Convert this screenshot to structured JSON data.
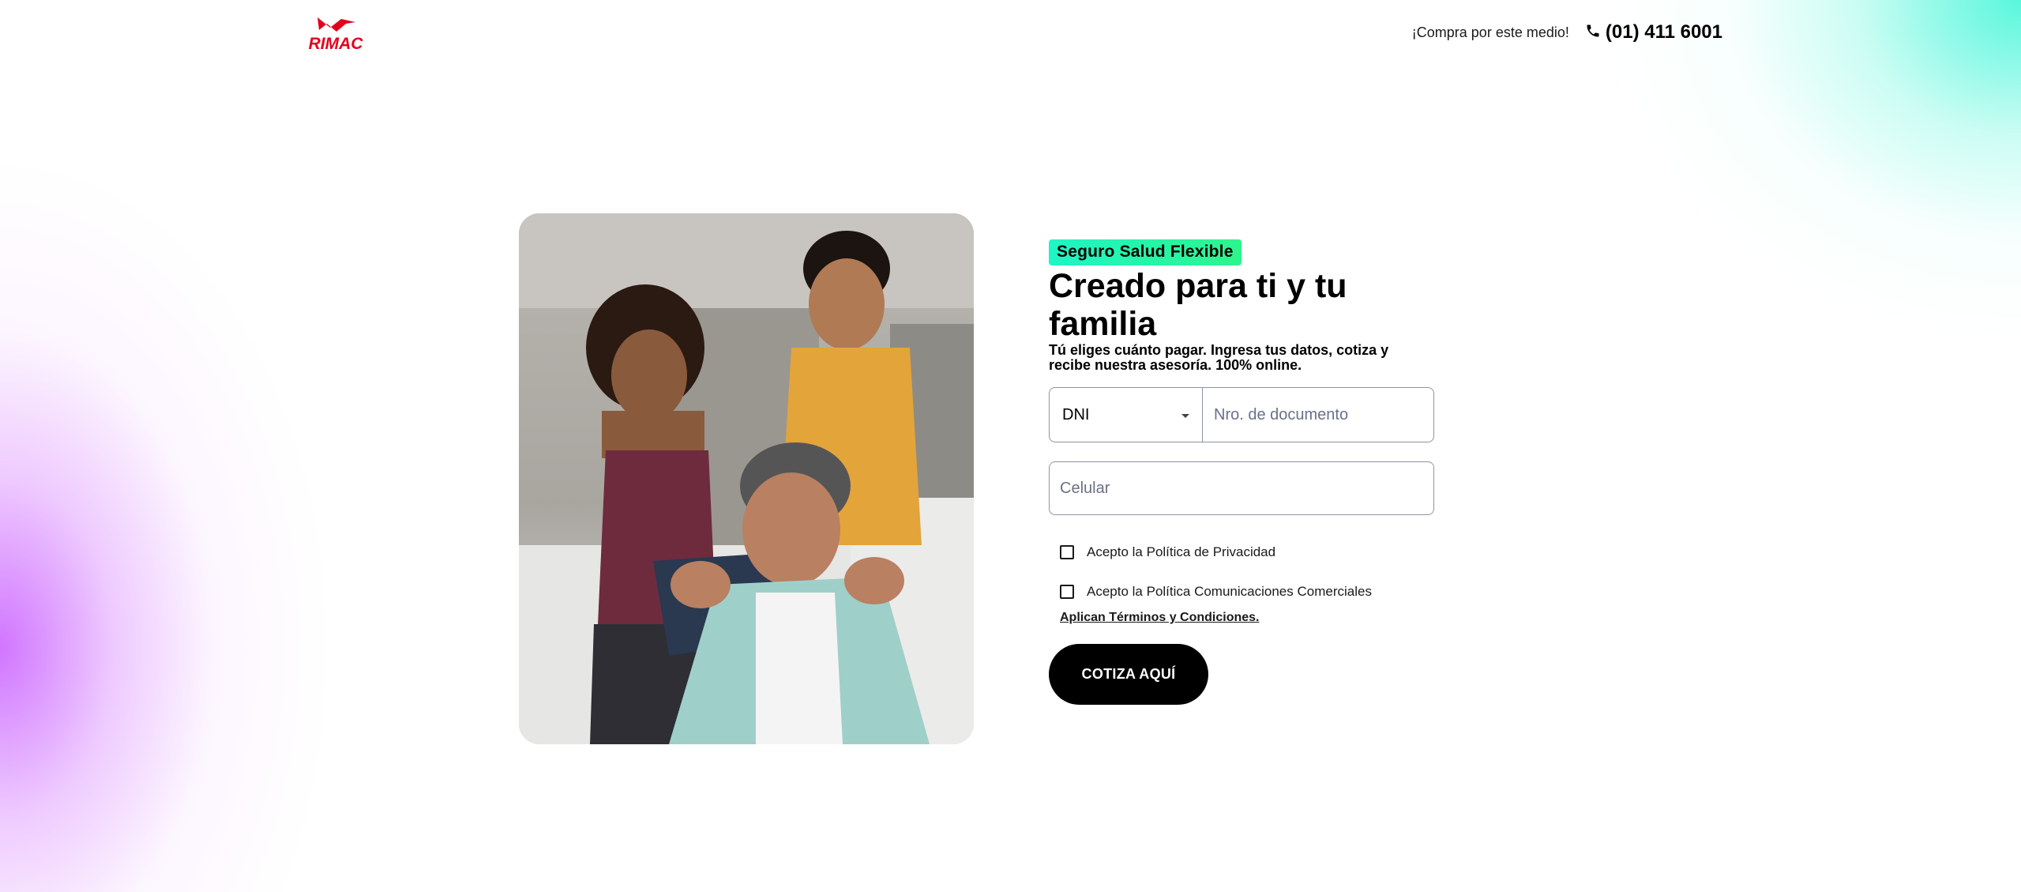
{
  "header": {
    "logo_text": "RIMAC",
    "buy_text": "¡Compra por este medio!",
    "phone_icon": "phone-icon",
    "phone_number": "(01) 411 6001"
  },
  "hero": {
    "image_icon": "family-photo"
  },
  "form": {
    "badge": "Seguro Salud Flexible",
    "title": "Creado para ti y tu familia",
    "subtitle": "Tú eliges cuánto pagar. Ingresa tus datos, cotiza y recibe nuestra asesoría. 100% online.",
    "doc_type_value": "DNI",
    "doc_number_placeholder": "Nro. de documento",
    "phone_placeholder": "Celular",
    "privacy_label": "Acepto la Política de Privacidad",
    "comms_label": "Acepto la Política Comunicaciones Comerciales",
    "terms_link": "Aplican Términos y Condiciones.",
    "cta_label": "COTIZA AQUÍ"
  },
  "colors": {
    "brand_red": "#e3001b",
    "badge_gradient_start": "#1ff5c6",
    "badge_gradient_end": "#2cf58c",
    "cta_bg": "#000000"
  }
}
